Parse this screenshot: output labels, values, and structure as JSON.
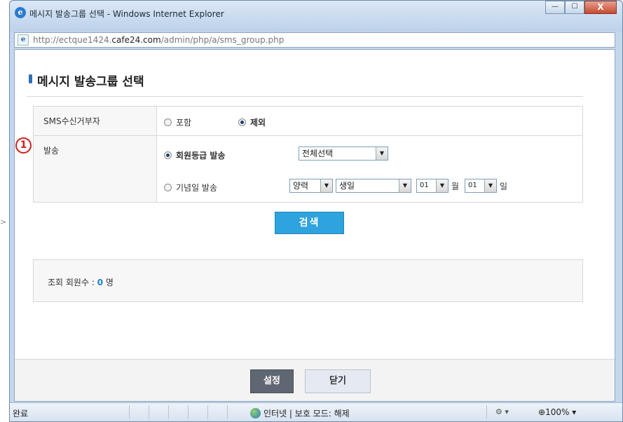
{
  "window": {
    "title": "메시지 발송그룹 선택 - Windows Internet Explorer",
    "url_prefix": "http://ectque1424.",
    "url_domain": "cafe24.com",
    "url_path": "/admin/php/a/sms_group.php",
    "minimize_label": "—",
    "maximize_label": "☐",
    "close_label": "X"
  },
  "page": {
    "title": "메시지 발송그룹 선택"
  },
  "form": {
    "refuse": {
      "label": "SMS수신거부자",
      "options": [
        {
          "label": "포함",
          "selected": false
        },
        {
          "label": "제외",
          "selected": true
        }
      ]
    },
    "send": {
      "label": "발송",
      "badge": "1",
      "grade": {
        "label": "회원등급 발송",
        "selected": true,
        "select_value": "전체선택"
      },
      "anniversary": {
        "label": "기념일 발송",
        "selected": false,
        "calendar_value": "양력",
        "type_value": "생일",
        "month_value": "01",
        "month_unit": "월",
        "day_value": "01",
        "day_unit": "일"
      }
    }
  },
  "search_button": "검색",
  "result": {
    "label": "조회 회원수 : ",
    "count": "0",
    "unit": " 명"
  },
  "footer": {
    "set_button": "설정",
    "close_button": "닫기"
  },
  "statusbar": {
    "status": "완료",
    "zone": "인터넷 | 보호 모드: 해제",
    "zoom": "100%"
  },
  "colors": {
    "accent": "#2ea3dd",
    "count": "#1f7fc2",
    "badge": "#d21e1e"
  }
}
